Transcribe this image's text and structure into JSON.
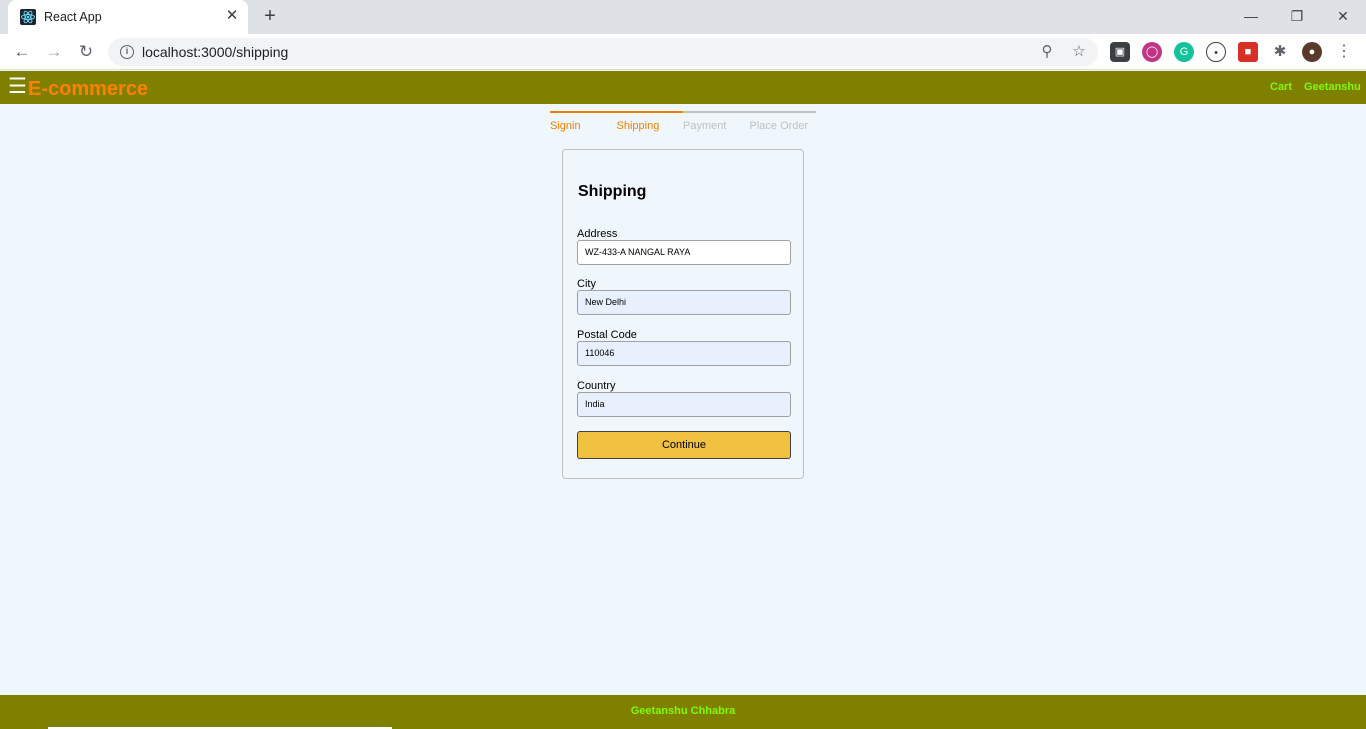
{
  "browser": {
    "tab_title": "React App",
    "url": "localhost:3000/shipping",
    "new_tab_glyph": "+",
    "close_glyph": "✕"
  },
  "app": {
    "brand": "E-commerce",
    "nav": {
      "cart": "Cart",
      "user": "Geetanshu"
    },
    "colors": {
      "navbar": "#808000",
      "brand": "#ff8000",
      "links": "#7cfc00",
      "step_active": "#f08000",
      "button": "#f0c040"
    }
  },
  "steps": [
    {
      "label": "Signin",
      "active": true
    },
    {
      "label": "Shipping",
      "active": true
    },
    {
      "label": "Payment",
      "active": false
    },
    {
      "label": "Place Order",
      "active": false
    }
  ],
  "form": {
    "title": "Shipping",
    "fields": [
      {
        "label": "Address",
        "value": "WZ-433-A   NANGAL RAYA"
      },
      {
        "label": "City",
        "value": "New Delhi"
      },
      {
        "label": "Postal Code",
        "value": "110046"
      },
      {
        "label": "Country",
        "value": "India"
      }
    ],
    "submit_label": "Continue"
  },
  "footer": {
    "text": "Geetanshu Chhabra"
  }
}
